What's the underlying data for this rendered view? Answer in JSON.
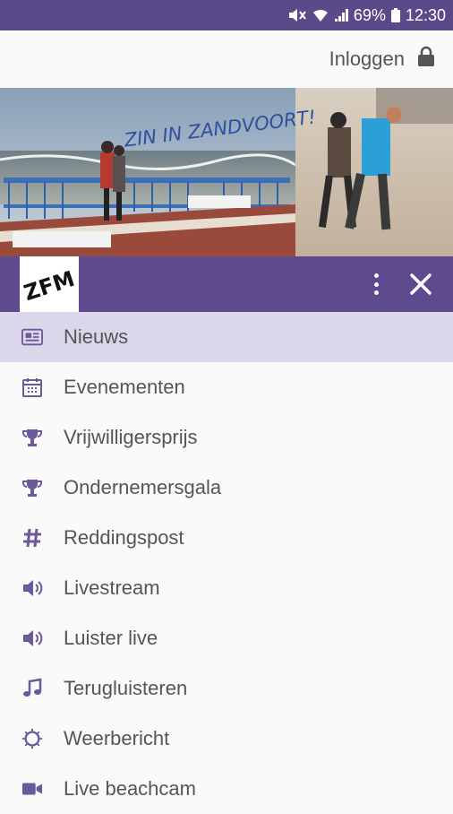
{
  "status": {
    "battery": "69%",
    "time": "12:30"
  },
  "header": {
    "login_label": "Inloggen"
  },
  "banner": {
    "slogan": "ZIN IN ZANDVOORT!"
  },
  "logo": {
    "text": "ZFM"
  },
  "colors": {
    "primary": "#5e4b8f",
    "active_bg": "#dcd6ea",
    "icon": "#6a5a9a",
    "text": "#555555"
  },
  "menu": {
    "items": [
      {
        "label": "Nieuws",
        "icon": "newspaper-icon"
      },
      {
        "label": "Evenementen",
        "icon": "calendar-icon"
      },
      {
        "label": "Vrijwilligersprijs",
        "icon": "trophy-icon"
      },
      {
        "label": "Ondernemersgala",
        "icon": "trophy-icon"
      },
      {
        "label": "Reddingspost",
        "icon": "hashtag-icon"
      },
      {
        "label": "Livestream",
        "icon": "speaker-icon"
      },
      {
        "label": "Luister live",
        "icon": "speaker-icon"
      },
      {
        "label": "Terugluisteren",
        "icon": "music-note-icon"
      },
      {
        "label": "Weerbericht",
        "icon": "sun-icon"
      },
      {
        "label": "Live beachcam",
        "icon": "video-camera-icon"
      }
    ]
  }
}
